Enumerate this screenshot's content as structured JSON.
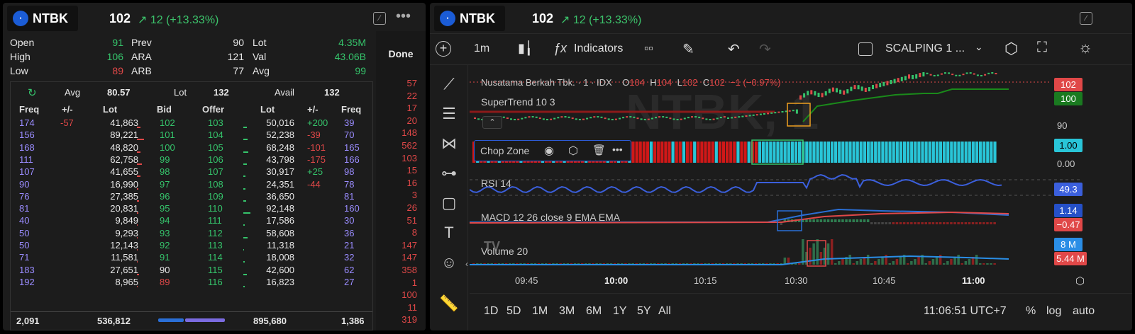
{
  "left": {
    "symbol": "NTBK",
    "price": "102",
    "change": "12 (+13.33%)",
    "stats": [
      {
        "a": "Open",
        "av": "91",
        "b": "Prev",
        "bv": "90",
        "c": "Lot",
        "cv": "4.35M"
      },
      {
        "a": "High",
        "av": "106",
        "b": "ARA",
        "bv": "121",
        "c": "Val",
        "cv": "43.06B"
      },
      {
        "a": "Low",
        "av": "89",
        "b": "ARB",
        "bv": "77",
        "c": "Avg",
        "cv": "99"
      }
    ],
    "summary": {
      "avg_label": "Avg",
      "avg": "80.57",
      "lot_label": "Lot",
      "lot": "132",
      "avail_label": "Avail",
      "avail": "132"
    },
    "headers": [
      "Freq",
      "+/-",
      "Lot",
      "Bid",
      "Offer",
      "Lot",
      "+/-",
      "Freq"
    ],
    "rows": [
      [
        "174",
        "-57",
        "41,863",
        "102",
        "103",
        "50,016",
        "+200",
        "39"
      ],
      [
        "156",
        "",
        "89,221",
        "101",
        "104",
        "52,238",
        "-39",
        "70"
      ],
      [
        "168",
        "",
        "48,820",
        "100",
        "105",
        "68,248",
        "-101",
        "165"
      ],
      [
        "111",
        "",
        "62,758",
        "99",
        "106",
        "43,798",
        "-175",
        "166"
      ],
      [
        "107",
        "",
        "41,655",
        "98",
        "107",
        "30,917",
        "+25",
        "98"
      ],
      [
        "90",
        "",
        "16,990",
        "97",
        "108",
        "24,351",
        "-44",
        "78"
      ],
      [
        "76",
        "",
        "27,385",
        "96",
        "109",
        "36,650",
        "",
        "81"
      ],
      [
        "81",
        "",
        "20,831",
        "95",
        "110",
        "92,148",
        "",
        "160"
      ],
      [
        "40",
        "",
        "9,849",
        "94",
        "111",
        "17,586",
        "",
        "30"
      ],
      [
        "50",
        "",
        "9,293",
        "93",
        "112",
        "58,608",
        "",
        "36"
      ],
      [
        "50",
        "",
        "12,143",
        "92",
        "113",
        "11,318",
        "",
        "21"
      ],
      [
        "71",
        "",
        "11,581",
        "91",
        "114",
        "18,008",
        "",
        "32"
      ],
      [
        "183",
        "",
        "27,651",
        "90",
        "115",
        "42,600",
        "",
        "62"
      ],
      [
        "192",
        "",
        "8,965",
        "89",
        "116",
        "16,823",
        "",
        "27"
      ]
    ],
    "totals": [
      "2,091",
      "536,812",
      "895,680",
      "1,386"
    ],
    "done_label": "Done",
    "done": [
      "57",
      "22",
      "17",
      "20",
      "148",
      "562",
      "103",
      "15",
      "16",
      "3",
      "26",
      "51",
      "8",
      "147",
      "147",
      "358",
      "1",
      "100",
      "11",
      "319"
    ]
  },
  "right": {
    "symbol": "NTBK",
    "price": "102",
    "change": "12 (+13.33%)",
    "interval": "1m",
    "indicators_label": "Indicators",
    "layout_name": "SCALPING 1 ...",
    "legend": {
      "name": "Nusatama Berkah Tbk. · 1 · IDX",
      "o": "O",
      "ov": "104",
      "h": "H",
      "hv": "104",
      "l": "L",
      "lv": "102",
      "c": "C",
      "cv": "102",
      "chg": "−1 (−0.97%)"
    },
    "watermark": "NTBK, 1",
    "supertrend": "SuperTrend 10 3",
    "chop": "Chop Zone",
    "rsi": "RSI 14",
    "macd": "MACD 12 26 close 9 EMA EMA",
    "volume": "Volume 20",
    "badges": {
      "price": "102",
      "st": "100",
      "p90": "90",
      "chop": "1.00",
      "chop0": "0.00",
      "rsi": "49.3",
      "macd1": "1.14",
      "macd2": "−0.47",
      "vol1": "8 M",
      "vol2": "5.44 M"
    },
    "times": [
      "09:45",
      "10:00",
      "10:15",
      "10:30",
      "10:45",
      "11:00"
    ],
    "ranges": [
      "1D",
      "5D",
      "1M",
      "3M",
      "6M",
      "1Y",
      "5Y",
      "All"
    ],
    "clock": "11:06:51 UTC+7",
    "pct": "%",
    "log": "log",
    "auto": "auto"
  },
  "colors": {
    "up": "#35c46b",
    "down": "#e04848",
    "freq": "#9a8cff",
    "cyan": "#29c5d8"
  }
}
